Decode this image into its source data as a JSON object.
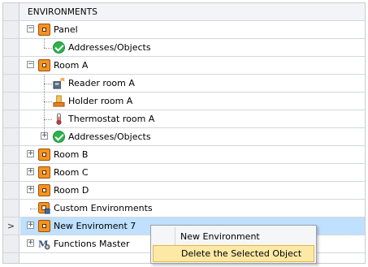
{
  "header": {
    "title": "ENVIRONMENTS"
  },
  "tree": [
    {
      "label": "Panel",
      "icon": "environment-icon"
    },
    {
      "label": "Addresses/Objects",
      "icon": "check-icon"
    },
    {
      "label": "Room A",
      "icon": "environment-icon"
    },
    {
      "label": "Reader room A",
      "icon": "card-reader-icon"
    },
    {
      "label": "Holder room A",
      "icon": "card-holder-icon"
    },
    {
      "label": "Thermostat room A",
      "icon": "thermostat-icon"
    },
    {
      "label": "Addresses/Objects",
      "icon": "check-icon"
    },
    {
      "label": "Room B",
      "icon": "environment-icon"
    },
    {
      "label": "Room C",
      "icon": "environment-icon"
    },
    {
      "label": "Room D",
      "icon": "environment-icon"
    },
    {
      "label": "Custom Environments",
      "icon": "custom-environment-icon"
    },
    {
      "label": "New Enviroment 7",
      "icon": "environment-icon",
      "selected": true
    },
    {
      "label": "Functions Master",
      "icon": "functions-master-icon"
    }
  ],
  "row_indicator": ">",
  "context_menu": {
    "items": [
      {
        "label": "New Environment"
      },
      {
        "label": "Delete the Selected Object",
        "highlighted": true
      }
    ]
  }
}
